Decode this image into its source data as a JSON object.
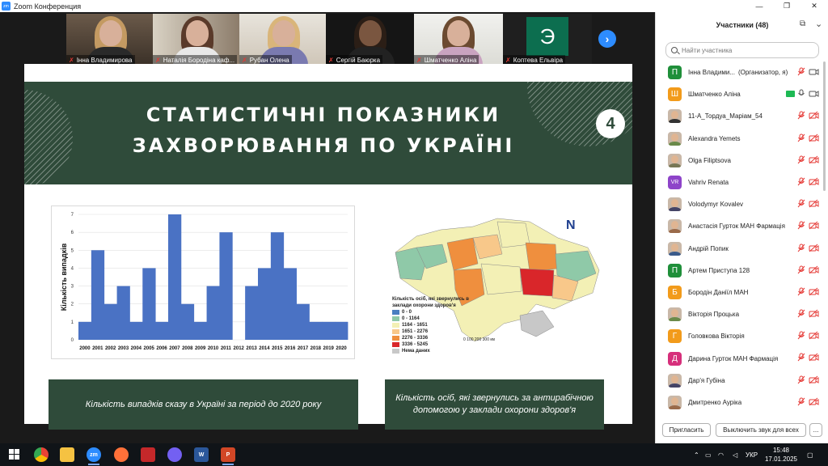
{
  "window": {
    "title": "Zoom Конференция",
    "logo_text": "zoom"
  },
  "gallery": {
    "tiles": [
      {
        "name": "Інна Владимирова"
      },
      {
        "name": "Наталія Бородіна каф..."
      },
      {
        "name": "Рубан Олена"
      },
      {
        "name": "Сергій Баюрка"
      },
      {
        "name": "Шматченко Аліна"
      },
      {
        "name": "Коптева Ельвіра",
        "avatar_letter": "Э"
      }
    ],
    "next_icon": "chevron-right-icon"
  },
  "slide": {
    "title_line1": "СТАТИСТИЧНІ ПОКАЗНИКИ",
    "title_line2": "ЗАХВОРЮВАННЯ ПО УКРАЇНІ",
    "number": "4",
    "caption_left": "Кількість випадків сказу в Україні за період до 2020 року",
    "caption_right": "Кількість осіб, які звернулись за антирабічною допомогою у заклади охорони здоров'я",
    "map": {
      "legend_title": "Кількість осіб, які звернулись в заклади охорони здоров'я",
      "legend": [
        {
          "label": "0 - 0",
          "color": "#4a7fc1"
        },
        {
          "label": "0 - 1164",
          "color": "#8fc9a8"
        },
        {
          "label": "1164 - 1651",
          "color": "#f3f0b5"
        },
        {
          "label": "1651 - 2276",
          "color": "#f8c88a"
        },
        {
          "label": "2276 - 3336",
          "color": "#ef8f3e"
        },
        {
          "label": "3336 - 5245",
          "color": "#d9262a"
        },
        {
          "label": "Нема даних",
          "color": "#c8c8c8"
        }
      ],
      "scale": "0    100    200    300 км",
      "north": "N"
    }
  },
  "chart_data": {
    "type": "bar",
    "categories": [
      "2000",
      "2001",
      "2002",
      "2003",
      "2004",
      "2005",
      "2006",
      "2007",
      "2008",
      "2009",
      "2010",
      "2011",
      "2012",
      "2013",
      "2014",
      "2015",
      "2016",
      "2017",
      "2018",
      "2019",
      "2020"
    ],
    "values": [
      1,
      5,
      2,
      3,
      1,
      4,
      1,
      7,
      2,
      1,
      3,
      6,
      0,
      3,
      4,
      6,
      4,
      2,
      1,
      1,
      1
    ],
    "ylabel": "Кількість випадків",
    "ylim": [
      0,
      7
    ],
    "yticks": [
      "0",
      "1",
      "2",
      "3",
      "4",
      "5",
      "6",
      "7"
    ],
    "bar_color": "#4a72c4",
    "grid": true
  },
  "participants": {
    "header": "Участники (48)",
    "search_placeholder": "Найти участника",
    "list": [
      {
        "name": "Інна Владими...",
        "role": "(Организатор, я)",
        "avatar": "П",
        "color": "#1f8f3a"
      },
      {
        "name": "Шматченко Аліна",
        "avatar": "Ш",
        "color": "#f29b1b",
        "sharing": true
      },
      {
        "name": "11-А_Тордуа_Маріам_54",
        "avatar": "",
        "color": "photo"
      },
      {
        "name": "Alexandra Yemets",
        "avatar": "",
        "color": "photo"
      },
      {
        "name": "Olga Filiptsova",
        "avatar": "",
        "color": "photo"
      },
      {
        "name": "Vahriv Renata",
        "avatar": "VR",
        "color": "#8e44c9"
      },
      {
        "name": "Volodymyr Kovalev",
        "avatar": "",
        "color": "photo"
      },
      {
        "name": "Анастасія Гурток МАН Фармація",
        "avatar": "",
        "color": "photo"
      },
      {
        "name": "Андрій Попик",
        "avatar": "",
        "color": "photo"
      },
      {
        "name": "Артем Приступа 128",
        "avatar": "П",
        "color": "#1f8f3a"
      },
      {
        "name": "Бородін Даніїл МАН",
        "avatar": "Б",
        "color": "#f29b1b"
      },
      {
        "name": "Вікторія Процька",
        "avatar": "",
        "color": "photo"
      },
      {
        "name": "Головкова Вікторія",
        "avatar": "Г",
        "color": "#f29b1b"
      },
      {
        "name": "Дарина Гурток МАН Фармація",
        "avatar": "Д",
        "color": "#d62f7b"
      },
      {
        "name": "Дар'я Губіна",
        "avatar": "",
        "color": "photo"
      },
      {
        "name": "Дмитренко Ауріка",
        "avatar": "",
        "color": "photo"
      }
    ],
    "invite_label": "Пригласить",
    "mute_all_label": "Выключить звук для всех",
    "more_label": "..."
  },
  "taskbar": {
    "language": "УКР",
    "time": "15:48",
    "date": "17.01.2025"
  }
}
